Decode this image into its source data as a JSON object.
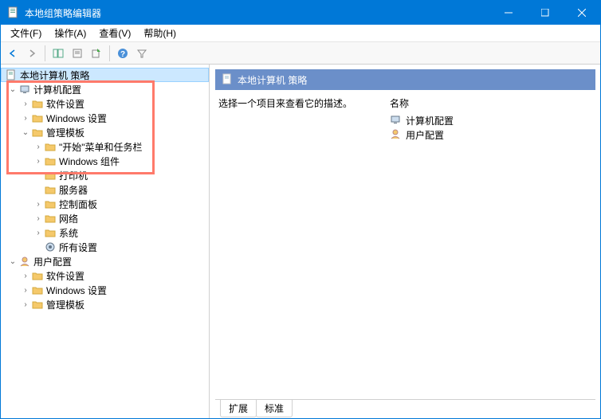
{
  "window": {
    "title": "本地组策略编辑器"
  },
  "menu": {
    "file": "文件(F)",
    "action": "操作(A)",
    "view": "查看(V)",
    "help": "帮助(H)"
  },
  "tree": {
    "root": "本地计算机 策略",
    "computer": "计算机配置",
    "comp_sw": "软件设置",
    "comp_win": "Windows 设置",
    "comp_admin": "管理模板",
    "start_task": "\"开始\"菜单和任务栏",
    "win_comp": "Windows 组件",
    "printers": "打印机",
    "server": "服务器",
    "ctrl_panel": "控制面板",
    "network": "网络",
    "system": "系统",
    "all_settings": "所有设置",
    "user": "用户配置",
    "user_sw": "软件设置",
    "user_win": "Windows 设置",
    "user_admin": "管理模板"
  },
  "right": {
    "header": "本地计算机 策略",
    "desc": "选择一个项目来查看它的描述。",
    "name_col": "名称",
    "items": {
      "comp": "计算机配置",
      "user": "用户配置"
    }
  },
  "tabs": {
    "extended": "扩展",
    "standard": "标准"
  }
}
